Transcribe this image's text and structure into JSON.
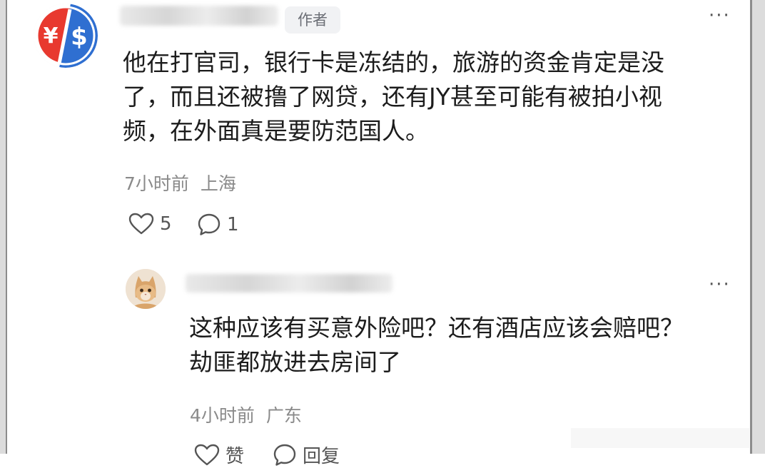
{
  "main_comment": {
    "author_badge": "作者",
    "text_lines": [
      "他在打官司，银行卡是冻结的，旅游的资金肯定是没",
      "了，而且还被撸了网贷，还有JY甚至可能有被拍小视",
      "频，在外面真是要防范国人。"
    ],
    "time": "7小时前",
    "location": "上海",
    "like_count": "5",
    "reply_count": "1",
    "avatar_icon": "yuan-dollar-logo-icon",
    "colors": {
      "avatar_red": "#e8392f",
      "avatar_blue": "#2f6fd1"
    }
  },
  "reply": {
    "text_lines": [
      "这种应该有买意外险吧？还有酒店应该会赔吧？",
      "劫匪都放进去房间了"
    ],
    "time": "4小时前",
    "location": "广东",
    "like_label": "赞",
    "reply_label": "回复",
    "avatar_icon": "cat-avatar-icon"
  },
  "more_label": "···"
}
